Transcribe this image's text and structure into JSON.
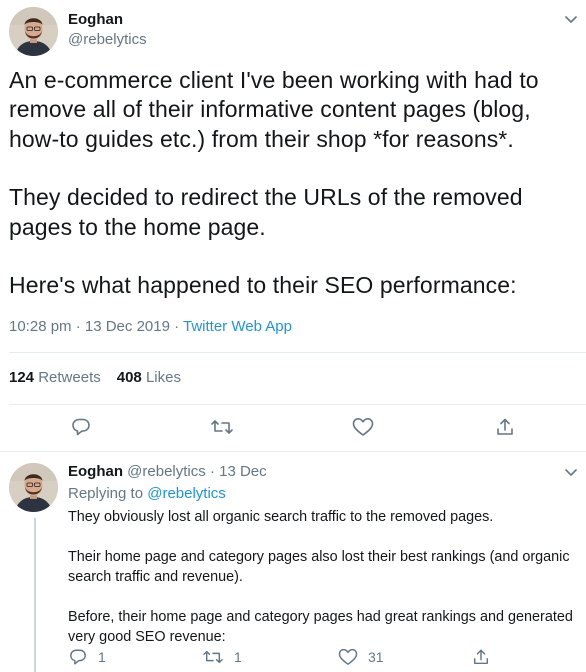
{
  "main_tweet": {
    "author_name": "Eoghan",
    "author_handle": "@rebelytics",
    "paragraphs": [
      "An e-commerce client I've been working with had to remove all of their informative content pages (blog, how-to guides etc.) from their shop *for reasons*.",
      "They decided to redirect the URLs of the removed pages to the home page.",
      "Here's what happened to their SEO performance:"
    ],
    "timestamp": "10:28 pm · 13 Dec 2019",
    "separator": " · ",
    "source": "Twitter Web App",
    "retweets_count": "124",
    "retweets_label": "Retweets",
    "likes_count": "408",
    "likes_label": "Likes",
    "actions": [
      "reply-icon",
      "retweet-icon",
      "like-icon",
      "share-icon"
    ]
  },
  "reply_tweet": {
    "author_name": "Eoghan",
    "author_handle": "@rebelytics",
    "date": "· 13 Dec",
    "replying_to_label": "Replying to",
    "replying_to_handle": "@rebelytics",
    "paragraphs": [
      "They obviously lost all organic search traffic to the removed pages.",
      "Their home page and category pages also lost their best rankings (and organic search traffic and revenue).",
      "Before, their home page and category pages had great rankings and generated very good SEO revenue:"
    ],
    "reply_count": "1",
    "retweet_count": "1",
    "like_count": "31"
  },
  "colors": {
    "text_primary": "#14171a",
    "text_secondary": "#657786",
    "link": "#1b95e0",
    "divider": "#e6ecf0"
  }
}
